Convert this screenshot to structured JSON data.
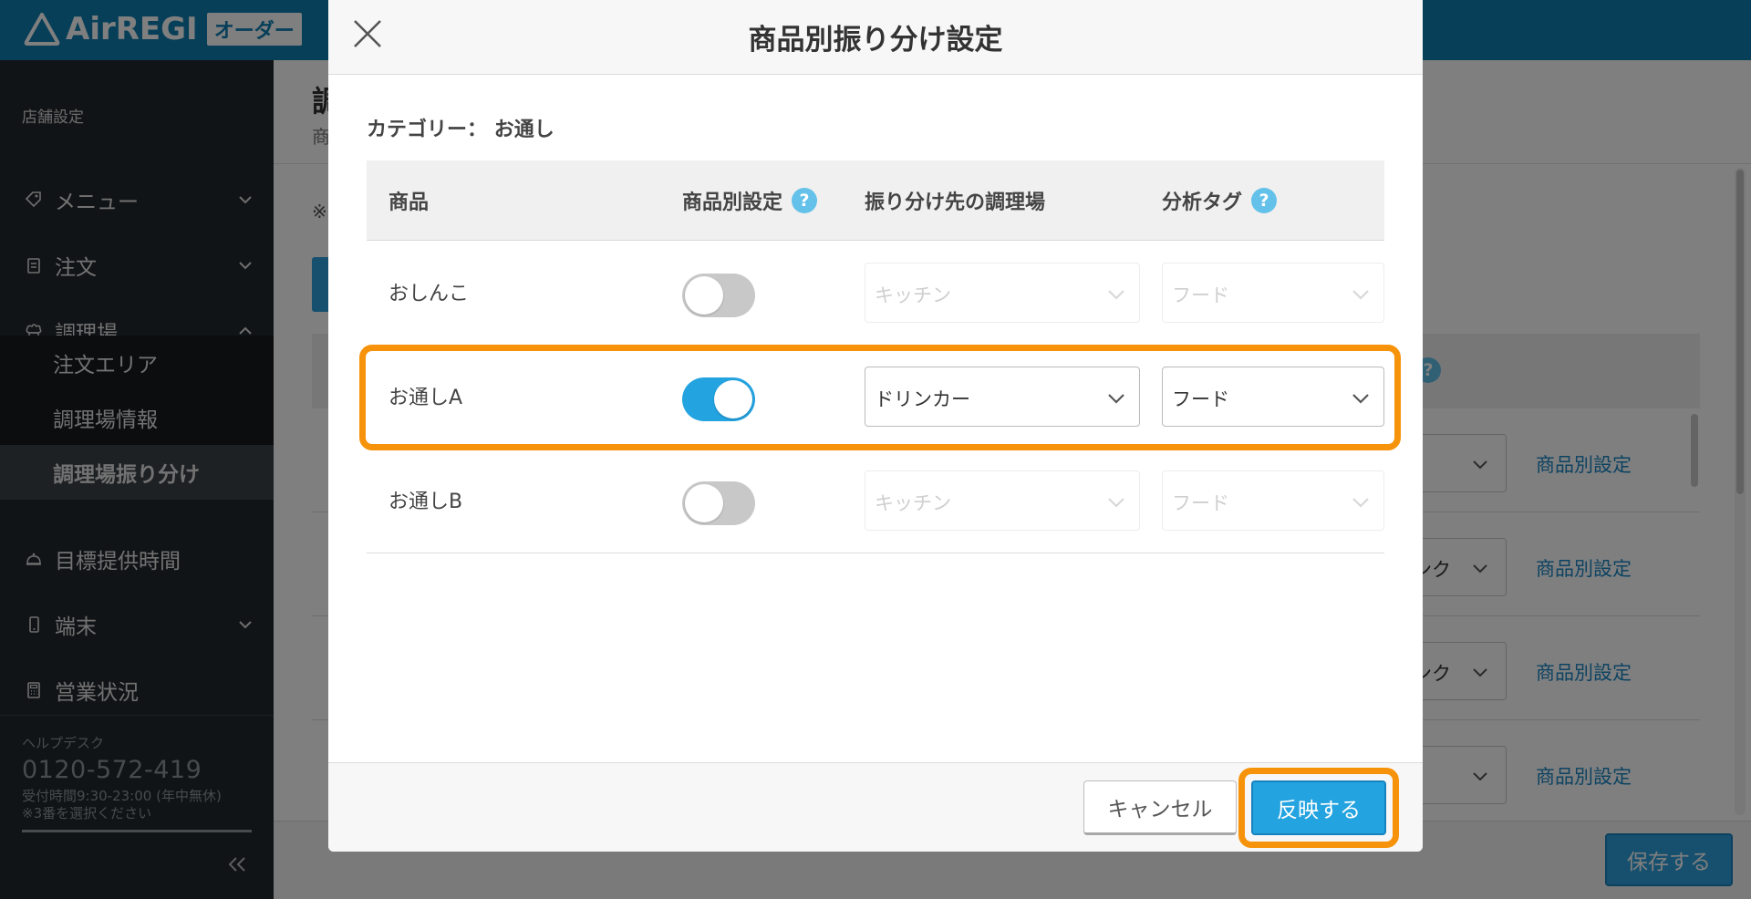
{
  "app": {
    "brand": "AirREGI",
    "badge": "オーダー"
  },
  "sidebar": {
    "section_title": "店舗設定",
    "items": [
      {
        "label": "メニュー",
        "icon": "tag-icon"
      },
      {
        "label": "注文",
        "icon": "clipboard-icon"
      },
      {
        "label": "調理場",
        "icon": "chef-hat-icon"
      },
      {
        "label": "目標提供時間",
        "icon": "bell-icon"
      },
      {
        "label": "端末",
        "icon": "phone-icon"
      },
      {
        "label": "営業状況",
        "icon": "calculator-icon"
      }
    ],
    "sub_items": [
      {
        "label": "注文エリア"
      },
      {
        "label": "調理場情報"
      },
      {
        "label": "調理場振り分け"
      }
    ],
    "help": {
      "label": "ヘルプデスク",
      "phone": "0120-572-419",
      "hours": "受付時間9:30-23:00 (年中無休)",
      "note": "※3番を選択ください"
    }
  },
  "background": {
    "title_fragment": "調",
    "subtitle_fragment": "商",
    "note_fragment": "※",
    "rows": [
      {
        "select_text": "",
        "link": "商品別設定"
      },
      {
        "select_text": "ンク",
        "link": "商品別設定"
      },
      {
        "select_text": "ンク",
        "link": "商品別設定"
      },
      {
        "select_text": "",
        "link": "商品別設定"
      }
    ],
    "save_label": "保存する"
  },
  "modal": {
    "title": "商品別振り分け設定",
    "category_label": "カテゴリー：",
    "category_value": "お通し",
    "columns": {
      "product": "商品",
      "per_item": "商品別設定",
      "kitchen": "振り分け先の調理場",
      "tag": "分析タグ",
      "help_glyph": "?"
    },
    "rows": [
      {
        "name": "おしんこ",
        "enabled": false,
        "kitchen": "キッチン",
        "tag": "フード"
      },
      {
        "name": "お通しA",
        "enabled": true,
        "kitchen": "ドリンカー",
        "tag": "フード"
      },
      {
        "name": "お通しB",
        "enabled": false,
        "kitchen": "キッチン",
        "tag": "フード"
      }
    ],
    "cancel_label": "キャンセル",
    "apply_label": "反映する"
  },
  "colors": {
    "header": "#0f7eb3",
    "sidebar": "#23292d",
    "accent": "#23a3e0",
    "highlight": "#f7930a"
  }
}
